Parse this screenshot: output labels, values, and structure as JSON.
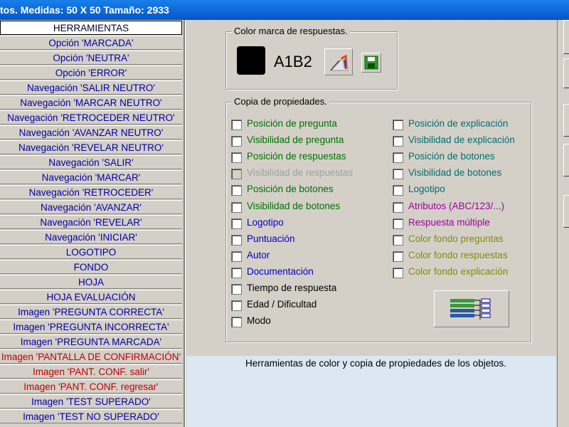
{
  "title": "tos. Medidas:  50 X  50  Tamaño:  2933",
  "menu": [
    {
      "label": "HERRAMIENTAS",
      "color": "#000033",
      "selected": true
    },
    {
      "label": "Opción 'MARCADA'",
      "color": "#0000a0"
    },
    {
      "label": "Opción 'NEUTRA'",
      "color": "#0000a0"
    },
    {
      "label": "Opción 'ERROR'",
      "color": "#0000a0"
    },
    {
      "label": "Navegación 'SALIR NEUTRO'",
      "color": "#0000a0"
    },
    {
      "label": "Navegación 'MARCAR NEUTRO'",
      "color": "#0000a0"
    },
    {
      "label": "Navegación 'RETROCEDER NEUTRO'",
      "color": "#0000a0"
    },
    {
      "label": "Navegación 'AVANZAR NEUTRO'",
      "color": "#0000a0"
    },
    {
      "label": "Navegación 'REVELAR NEUTRO'",
      "color": "#0000a0"
    },
    {
      "label": "Navegación 'SALIR'",
      "color": "#0000a0"
    },
    {
      "label": "Navegación 'MARCAR'",
      "color": "#0000a0"
    },
    {
      "label": "Navegación 'RETROCEDER'",
      "color": "#0000a0"
    },
    {
      "label": "Navegación 'AVANZAR'",
      "color": "#0000a0"
    },
    {
      "label": "Navegación 'REVELAR'",
      "color": "#0000a0"
    },
    {
      "label": "Navegación 'INICIAR'",
      "color": "#0000a0"
    },
    {
      "label": "LOGOTIPO",
      "color": "#0000a0"
    },
    {
      "label": "FONDO",
      "color": "#0000a0"
    },
    {
      "label": "HOJA",
      "color": "#0000a0"
    },
    {
      "label": "HOJA EVALUACIÓN",
      "color": "#0000a0"
    },
    {
      "label": "Imagen 'PREGUNTA CORRECTA'",
      "color": "#0000a0"
    },
    {
      "label": "Imagen 'PREGUNTA INCORRECTA'",
      "color": "#0000a0"
    },
    {
      "label": "Imagen 'PREGUNTA MARCADA'",
      "color": "#0000a0"
    },
    {
      "label": "Imagen 'PANTALLA DE CONFIRMACIÓN'",
      "color": "#c00000"
    },
    {
      "label": "Imagen 'PANT. CONF. salir'",
      "color": "#c00000"
    },
    {
      "label": "Imagen 'PANT. CONF. regresar'",
      "color": "#c00000"
    },
    {
      "label": "Imagen 'TEST SUPERADO'",
      "color": "#0000a0"
    },
    {
      "label": "Imagen 'TEST NO SUPERADO'",
      "color": "#0000a0"
    }
  ],
  "color_group": {
    "title": "Color marca de respuestas.",
    "code": "A1B2",
    "swatch_color": "#000000"
  },
  "copy_group": {
    "title": "Copia de propiedades.",
    "left": [
      {
        "label": "Posición de pregunta",
        "color": "#007000"
      },
      {
        "label": "Visibilidad de pregunta",
        "color": "#007000"
      },
      {
        "label": "Posición de respuestas",
        "color": "#007000"
      },
      {
        "label": "Visibilidad de respuestas",
        "color": "#a0a0a0",
        "disabled": true
      },
      {
        "label": "Posición de botones",
        "color": "#007000"
      },
      {
        "label": "Visibilidad de botones",
        "color": "#007000"
      },
      {
        "label": "Logotipo",
        "color": "#0000c0"
      },
      {
        "label": "Puntuación",
        "color": "#0000c0"
      },
      {
        "label": "Autor",
        "color": "#0000c0"
      },
      {
        "label": "Documentación",
        "color": "#0000c0"
      },
      {
        "label": "Tiempo de respuesta",
        "color": "#000000"
      },
      {
        "label": "Edad / Dificultad",
        "color": "#000000"
      },
      {
        "label": "Modo",
        "color": "#000000"
      }
    ],
    "right": [
      {
        "label": "Posición de explicación",
        "color": "#007070"
      },
      {
        "label": "Visibilidad de explicación",
        "color": "#007070"
      },
      {
        "label": "Posición de botones",
        "color": "#007070"
      },
      {
        "label": "Visibilidad de botones",
        "color": "#007070"
      },
      {
        "label": "Logotipo",
        "color": "#007070"
      },
      {
        "label": "Atributos (ABC/123/...)",
        "color": "#a000a0"
      },
      {
        "label": "Respuesta múltiple",
        "color": "#a000a0"
      },
      {
        "label": "Color fondo preguntas",
        "color": "#8a8a00"
      },
      {
        "label": "Color fondo respuestas",
        "color": "#8a8a00"
      },
      {
        "label": "Color fondo explicación",
        "color": "#8a8a00"
      }
    ]
  },
  "status": "Herramientas de color y copia de propiedades de los objetos."
}
